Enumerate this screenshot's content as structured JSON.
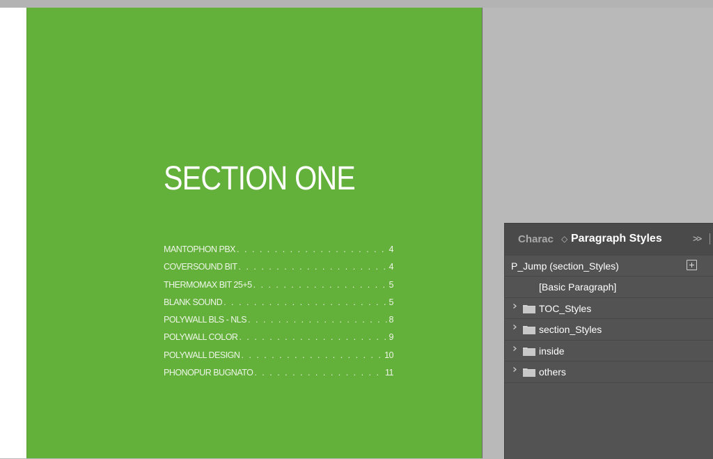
{
  "document": {
    "section_title": "SECTION ONE",
    "toc": [
      {
        "label": "MANTOPHON PBX",
        "page": "4"
      },
      {
        "label": "COVERSOUND BIT",
        "page": "4"
      },
      {
        "label": "THERMOMAX BIT 25+5",
        "page": "5"
      },
      {
        "label": "BLANK SOUND",
        "page": "5"
      },
      {
        "label": "POLYWALL BLS - NLS",
        "page": "8"
      },
      {
        "label": "POLYWALL COLOR",
        "page": "9"
      },
      {
        "label": "POLYWALL DESIGN",
        "page": "10"
      },
      {
        "label": "PHONOPUR BUGNATO",
        "page": "11"
      }
    ],
    "page_color": "#63b03a"
  },
  "panel": {
    "tab_inactive": "Charac",
    "tab_arrow": "◇",
    "tab_active": "Paragraph Styles",
    "menu_glyph": ">>",
    "current_style": "P_Jump (section_Styles)",
    "basic_style": "[Basic Paragraph]",
    "groups": [
      {
        "label": "TOC_Styles"
      },
      {
        "label": "section_Styles"
      },
      {
        "label": "inside"
      },
      {
        "label": "others"
      }
    ]
  }
}
